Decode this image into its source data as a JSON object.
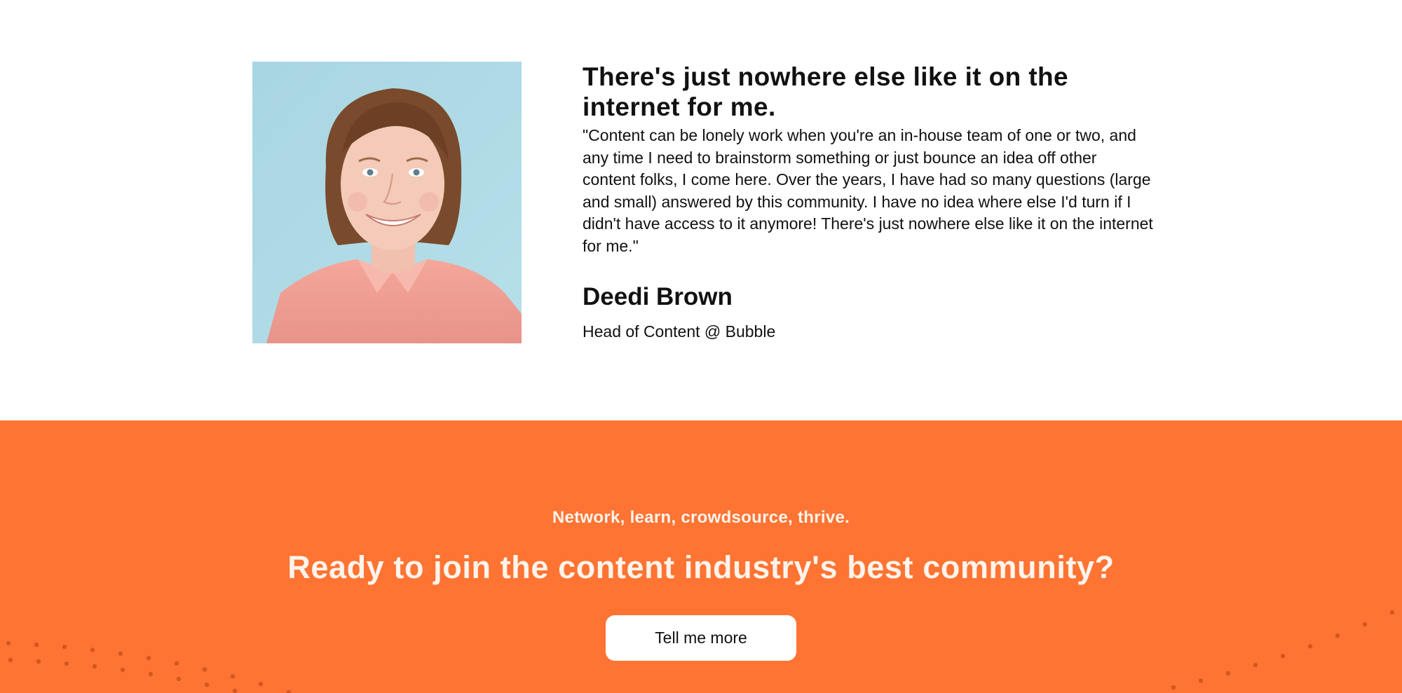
{
  "testimonial": {
    "headline": "There's just nowhere else like it on the internet for me.",
    "quote": "\"Content can be lonely work when you're an in-house team of one or two, and any time I need to brainstorm something or just bounce an idea off other content folks, I come here. Over the years, I have had so many questions (large and small) answered by this community. I have no idea where else I'd turn if I didn't have access to it anymore! There's just nowhere else like it on the internet for me.\"",
    "name": "Deedi Brown",
    "role": "Head of Content @ Bubble",
    "photo_icon": "portrait-photo"
  },
  "cta": {
    "eyebrow": "Network, learn, crowdsource, thrive.",
    "title": "Ready to join the content industry's best community?",
    "button_label": "Tell me more",
    "background_color": "#ff7433",
    "dot_color": "#d2571f"
  }
}
